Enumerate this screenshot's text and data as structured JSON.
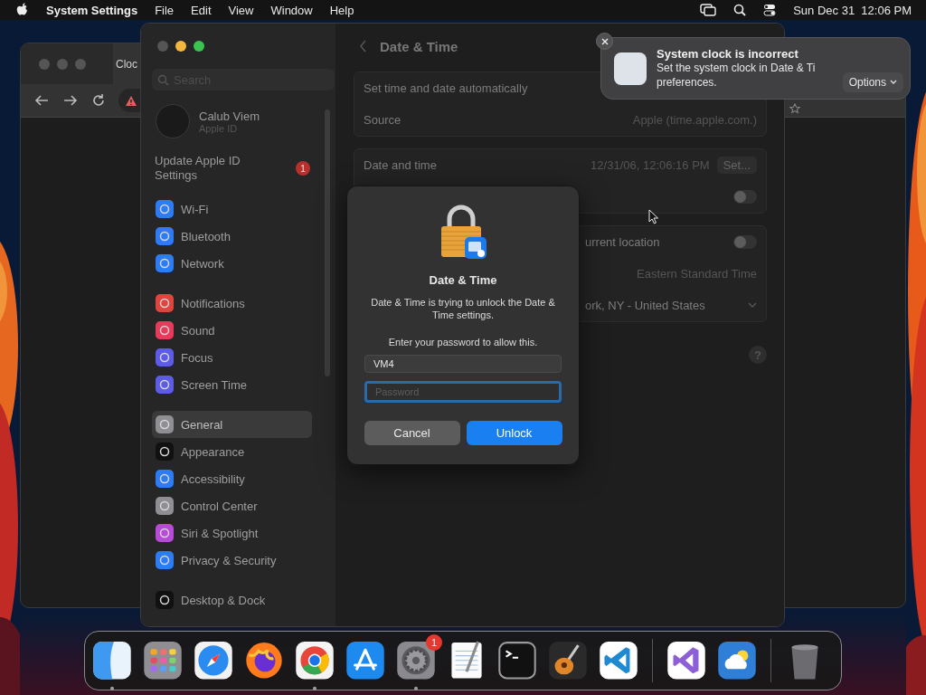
{
  "menu_bar": {
    "app_name": "System Settings",
    "menus": [
      "File",
      "Edit",
      "View",
      "Window",
      "Help"
    ],
    "clock": "Sun Dec 31  12:06 PM"
  },
  "browser_window": {
    "tab_title": "Cloc"
  },
  "settings_window": {
    "search": {
      "placeholder": "Search"
    },
    "account": {
      "name": "Calub Viem",
      "subtitle": "Apple ID"
    },
    "update_notice": {
      "label": "Update Apple ID Settings",
      "badge": "1"
    },
    "sidebar_groups": [
      {
        "items": [
          {
            "label": "Wi-Fi",
            "color": "#2d7cf6",
            "selected": false
          },
          {
            "label": "Bluetooth",
            "color": "#2d7cf6",
            "selected": false
          },
          {
            "label": "Network",
            "color": "#2d7cf6",
            "selected": false
          }
        ]
      },
      {
        "items": [
          {
            "label": "Notifications",
            "color": "#e0443e",
            "selected": false
          },
          {
            "label": "Sound",
            "color": "#e63b5a",
            "selected": false
          },
          {
            "label": "Focus",
            "color": "#5e5ce6",
            "selected": false
          },
          {
            "label": "Screen Time",
            "color": "#5e5ce6",
            "selected": false
          }
        ]
      },
      {
        "items": [
          {
            "label": "General",
            "color": "#8e8e93",
            "selected": true
          },
          {
            "label": "Appearance",
            "color": "#111111",
            "selected": false
          },
          {
            "label": "Accessibility",
            "color": "#2d7cf6",
            "selected": false
          },
          {
            "label": "Control Center",
            "color": "#8e8e93",
            "selected": false
          },
          {
            "label": "Siri & Spotlight",
            "color": "#b84ad8",
            "selected": false
          },
          {
            "label": "Privacy & Security",
            "color": "#2d7cf6",
            "selected": false
          }
        ]
      },
      {
        "items": [
          {
            "label": "Desktop & Dock",
            "color": "#111111",
            "selected": false
          }
        ]
      }
    ],
    "page_title": "Date & Time",
    "sections": [
      {
        "rows": [
          {
            "kind": "text",
            "label": "Set time and date automatically"
          },
          {
            "kind": "value",
            "label": "Source",
            "value": "Apple (time.apple.com.)"
          }
        ]
      },
      {
        "rows": [
          {
            "kind": "button",
            "label": "Date and time",
            "value": "12/31/06, 12:06:16 PM",
            "button": "Set..."
          },
          {
            "kind": "toggle",
            "on": false
          }
        ]
      },
      {
        "rows": [
          {
            "kind": "toggle",
            "label": "urrent location",
            "on": false,
            "covered": true
          },
          {
            "kind": "value",
            "value": "Eastern Standard Time"
          },
          {
            "kind": "popup",
            "value": "ork, NY - United States",
            "covered": true
          }
        ]
      }
    ],
    "help_button": "?"
  },
  "auth_dialog": {
    "title": "Date & Time",
    "message": "Date & Time is trying to unlock the Date & Time settings.",
    "prompt": "Enter your password to allow this.",
    "username": "VM4",
    "password_placeholder": "Password",
    "buttons": [
      {
        "label": "Cancel",
        "kind": "secondary"
      },
      {
        "label": "Unlock",
        "kind": "primary"
      }
    ]
  },
  "notification": {
    "title": "System clock is incorrect",
    "body": [
      "Set the system clock in Date & Ti",
      "preferences."
    ],
    "options_button": "Options"
  },
  "dock": {
    "groups": [
      {
        "apps": [
          {
            "kind": "finder",
            "running": true
          },
          {
            "kind": "launchpad",
            "running": false
          },
          {
            "kind": "safari",
            "running": false
          },
          {
            "kind": "firefox",
            "running": false
          },
          {
            "kind": "chrome",
            "running": true
          },
          {
            "kind": "appstore",
            "running": false
          },
          {
            "kind": "settings",
            "running": true,
            "badge": "1"
          },
          {
            "kind": "textedit",
            "running": false
          },
          {
            "kind": "terminal",
            "running": false
          },
          {
            "kind": "garageband",
            "running": false
          },
          {
            "kind": "vscode",
            "running": false
          }
        ]
      },
      {
        "apps": [
          {
            "kind": "visualstudio",
            "running": false
          },
          {
            "kind": "weather",
            "running": false
          }
        ]
      },
      {
        "apps": [
          {
            "kind": "trash",
            "running": false
          }
        ]
      }
    ]
  }
}
